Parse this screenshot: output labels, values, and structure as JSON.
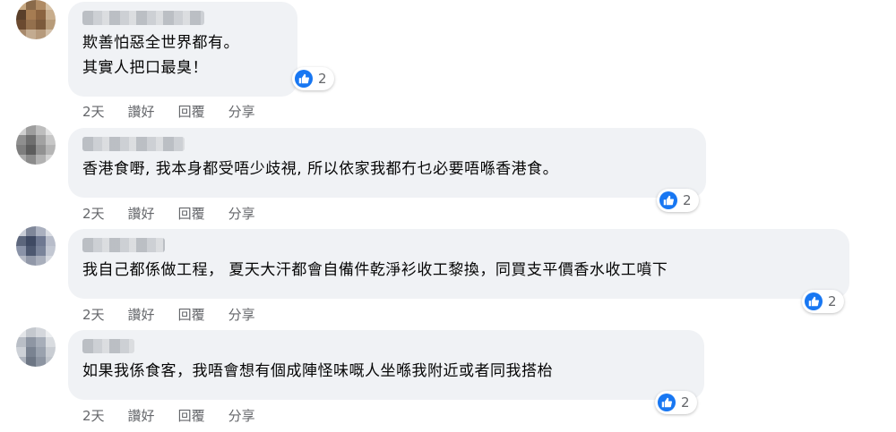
{
  "comments": [
    {
      "text_lines": [
        "欺善怕惡全世界都有。",
        "其實人把口最臭！"
      ],
      "reaction_count": "2",
      "time": "2天",
      "like_label": "讚好",
      "reply_label": "回覆",
      "share_label": "分享"
    },
    {
      "text_lines": [
        "香港食嘢, 我本身都受唔少歧視, 所以依家我都冇乜必要唔喺香港食。"
      ],
      "reaction_count": "2",
      "time": "2天",
      "like_label": "讚好",
      "reply_label": "回覆",
      "share_label": "分享"
    },
    {
      "text_lines": [
        "我自己都係做工程， 夏天大汗都會自備件乾淨衫收工黎換，同買支平價香水收工噴下"
      ],
      "reaction_count": "2",
      "time": "2天",
      "like_label": "讚好",
      "reply_label": "回覆",
      "share_label": "分享"
    },
    {
      "text_lines": [
        "如果我係食客，我唔會想有個成陣怪味嘅人坐喺我附近或者同我搭枱"
      ],
      "reaction_count": "2",
      "time": "2天",
      "like_label": "讚好",
      "reply_label": "回覆",
      "share_label": "分享"
    }
  ],
  "colors": {
    "bubble": "#f0f2f5",
    "like_blue": "#1877f2",
    "meta_text": "#65676b"
  },
  "icons": {
    "reaction": "thumbs-up-icon"
  }
}
